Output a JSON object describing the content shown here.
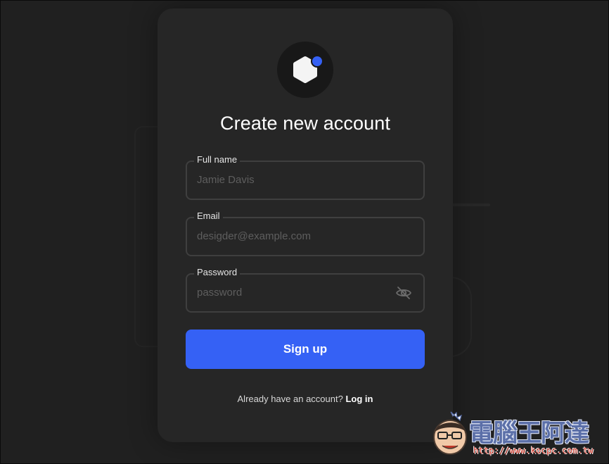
{
  "form": {
    "title": "Create new account",
    "fields": [
      {
        "label": "Full name",
        "placeholder": "Jamie Davis"
      },
      {
        "label": "Email",
        "placeholder": "desigder@example.com"
      },
      {
        "label": "Password",
        "placeholder": "password",
        "toggle_icon": "eye-off-icon"
      }
    ],
    "submit_label": "Sign up",
    "footer_text": "Already have an account?",
    "footer_link": "Log in"
  },
  "logo": {
    "icon": "hexagon-logo-icon",
    "dot_color": "#3561f5"
  },
  "colors": {
    "accent": "#3561f5",
    "card": "#262626",
    "background": "#202020"
  },
  "watermark": {
    "title": "電腦王阿達",
    "url": "http://www.kocpc.com.tw"
  }
}
